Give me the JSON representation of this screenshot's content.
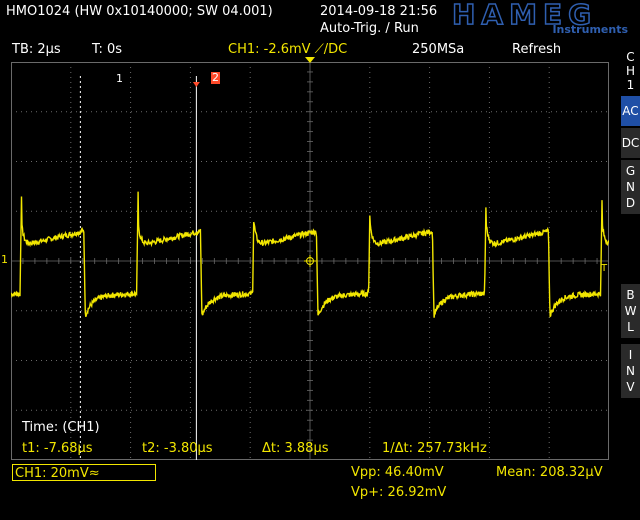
{
  "device": {
    "id_line": "HMO1024 (HW 0x10140000; SW 04.001)",
    "datetime": "2014-09-18 21:56",
    "trigger_state": "Auto-Trig. / Run",
    "brand": "HAMEG",
    "brand_sub": "Instruments"
  },
  "status_bar": {
    "timebase": "TB: 2µs",
    "trigger_time": "T: 0s",
    "channel_info": "CH1: -2.6mV ⟋/DC",
    "sample_rate": "250MSa",
    "mode": "Refresh"
  },
  "side_menu": {
    "channel": [
      "C",
      "H",
      "1"
    ],
    "buttons": [
      {
        "label": [
          "AC"
        ],
        "active": true
      },
      {
        "label": [
          "DC"
        ],
        "active": false
      },
      {
        "label": [
          "G",
          "N",
          "D"
        ],
        "active": false
      },
      {
        "label": [
          "B",
          "W",
          "L"
        ],
        "active": false
      },
      {
        "label": [
          "I",
          "N",
          "V"
        ],
        "active": false
      }
    ]
  },
  "cursors": {
    "cursor1_label": "1",
    "cursor2_label": "2",
    "title": "Time: (CH1)",
    "t1": "t1: -7.68µs",
    "t2": "t2: -3.80µs",
    "dt": "Δt: 3.88µs",
    "inv_dt": "1/Δt: 257.73kHz"
  },
  "markers": {
    "ch_marker": "1",
    "trigger_marker": "T"
  },
  "footer": {
    "ch1_scale": "CH1: 20mV≈",
    "vpp": "Vpp: 46.40mV",
    "vpplus": "Vp+: 26.92mV",
    "mean": "Mean: 208.32µV"
  },
  "colors": {
    "trace": "#f2e600",
    "grid": "#6a6a6a",
    "cursor2": "#ff4a2a",
    "active_button": "#1f4fa6"
  },
  "chart_data": {
    "type": "line",
    "title": "",
    "xlabel": "",
    "ylabel": "",
    "x_unit": "µs",
    "y_unit": "mV",
    "xlim": [
      -10,
      10
    ],
    "ylim": [
      -80,
      80
    ],
    "series": [
      {
        "name": "CH1",
        "period_us": 3.88,
        "edge_times_us": [
          -9.7,
          -5.8,
          -1.92,
          1.96,
          5.84,
          9.72
        ],
        "peak_high_mV": 26.92,
        "low_plateau_mV": -14,
        "high_plateau_mV": 10,
        "vpp_mV": 46.4
      }
    ]
  }
}
